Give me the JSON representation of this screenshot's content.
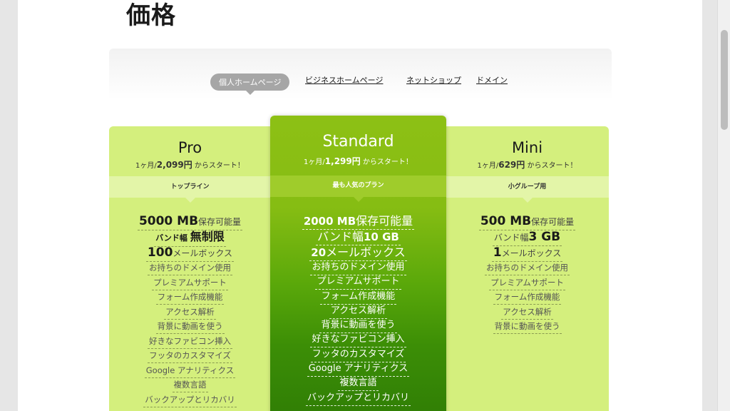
{
  "page": {
    "title": "価格"
  },
  "tabs": [
    {
      "label": "個人ホームページ",
      "active": true
    },
    {
      "label": "ビジネスホームページ",
      "active": false
    },
    {
      "label": "ネットショップ",
      "active": false
    },
    {
      "label": "ドメイン",
      "active": false
    }
  ],
  "plans": {
    "pro": {
      "name": "Pro",
      "price_prefix": "1ヶ月/",
      "price": "2,099円",
      "price_suffix": " からスタート！",
      "ribbon": "トップライン",
      "storage_value": "5000 MB",
      "storage_label": " 保存可能量",
      "bandwidth_label": "バンド幅 ",
      "bandwidth_value": "無制限",
      "mailbox_value": "100",
      "mailbox_label": "メールボックス",
      "features": [
        "お持ちのドメイン使用",
        "プレミアムサポート",
        "フォーム作成機能",
        "アクセス解析",
        "背景に動画を使う",
        "好きなファビコン挿入",
        "フッタのカスタマイズ",
        "Google アナリティクス",
        "複数言語",
        "バックアップとリカバリ"
      ]
    },
    "standard": {
      "name": "Standard",
      "price_prefix": "1ヶ月/",
      "price": "1,299円",
      "price_suffix": " からスタート！",
      "ribbon": "最も人気のプラン",
      "storage_value": "2000 MB",
      "storage_label": " 保存可能量",
      "bandwidth_label": "バンド幅",
      "bandwidth_value": "10 GB",
      "mailbox_value": "20",
      "mailbox_label": "メールボックス",
      "features": [
        "お持ちのドメイン使用",
        "プレミアムサポート",
        "フォーム作成機能",
        "アクセス解析",
        "背景に動画を使う",
        "好きなファビコン挿入",
        "フッタのカスタマイズ",
        "Google アナリティクス",
        "複数言語",
        "バックアップとリカバリ"
      ]
    },
    "mini": {
      "name": "Mini",
      "price_prefix": "1ヶ月/",
      "price": "629円",
      "price_suffix": " からスタート！",
      "ribbon": "小グループ用",
      "storage_value": "500 MB",
      "storage_label": " 保存可能量",
      "bandwidth_label": "バンド幅",
      "bandwidth_value": "3 GB",
      "mailbox_value": "1",
      "mailbox_label": "メールボックス",
      "features": [
        "お持ちのドメイン使用",
        "プレミアムサポート",
        "フォーム作成機能",
        "アクセス解析",
        "背景に動画を使う"
      ]
    }
  },
  "colors": {
    "side_plan_bg": "#d4ef7d",
    "standard_top": "#8dc015",
    "standard_bottom": "#2f7d05",
    "active_tab_bg": "#a6a6a6"
  }
}
